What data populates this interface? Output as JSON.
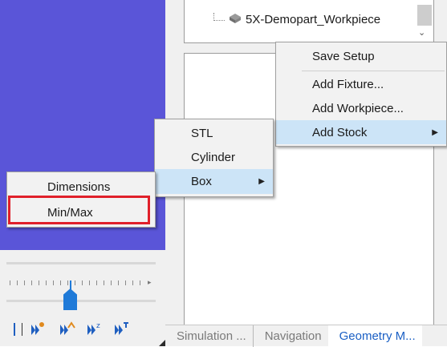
{
  "tree": {
    "item_label": "5X-Demopart_Workpiece"
  },
  "setup_menu": {
    "items": [
      {
        "label": "Save Setup"
      },
      {
        "label": "Add Fixture..."
      },
      {
        "label": "Add Workpiece..."
      },
      {
        "label": "Add Stock"
      }
    ]
  },
  "stock_menu": {
    "items": [
      {
        "label": "STL"
      },
      {
        "label": "Cylinder"
      },
      {
        "label": "Box"
      }
    ]
  },
  "box_menu": {
    "items": [
      {
        "label": "Dimensions"
      },
      {
        "label": "Min/Max"
      }
    ]
  },
  "tabs": [
    {
      "label": "Simulation ..."
    },
    {
      "label": "Navigation"
    },
    {
      "label": "Geometry M..."
    }
  ],
  "toolbar": {
    "icons": [
      "pause-icon",
      "step-point-icon",
      "step-axis-icon",
      "step-z-icon",
      "step-tool-icon"
    ]
  },
  "colors": {
    "viewport": "#5a55d8",
    "menu_highlight": "#cce4f7",
    "annotation_red": "#e0202a",
    "slider_blue": "#1f7ad8",
    "active_tab": "#1a5fc4"
  }
}
